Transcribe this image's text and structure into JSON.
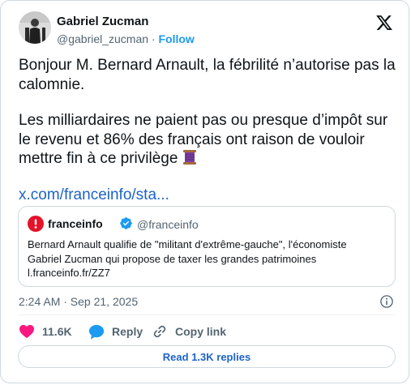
{
  "author": {
    "name": "Gabriel Zucman",
    "handle": "@gabriel_zucman",
    "separator": "·",
    "follow_label": "Follow"
  },
  "tweet": {
    "paragraph1": "Bonjour M. Bernard Arnault, la fébrilité n’autorise pas la calomnie.",
    "paragraph2": "Les milliardaires ne paient pas ou presque d’impôt sur le revenu et 86% des français ont raison de vouloir mettre fin à ce privilège",
    "emoji": "spool-of-thread-icon",
    "link": "x.com/franceinfo/sta..."
  },
  "quote": {
    "name": "franceinfo",
    "handle": "@franceinfo",
    "line1": "Bernard Arnault qualifie de \"militant d'extrême-gauche\", l'économiste",
    "line2": "Gabriel Zucman qui propose de taxer les grandes patrimoines",
    "line3": "l.franceinfo.fr/ZZ7"
  },
  "timestamp": "2:24 AM · Sep 21, 2025",
  "actions": {
    "likes": "11.6K",
    "reply": "Reply",
    "copy": "Copy link"
  },
  "replies_button": "Read 1.3K replies",
  "colors": {
    "accent": "#1d9bf0",
    "link": "#1d63c6",
    "like": "#f91880",
    "brand": "#e3132a"
  }
}
